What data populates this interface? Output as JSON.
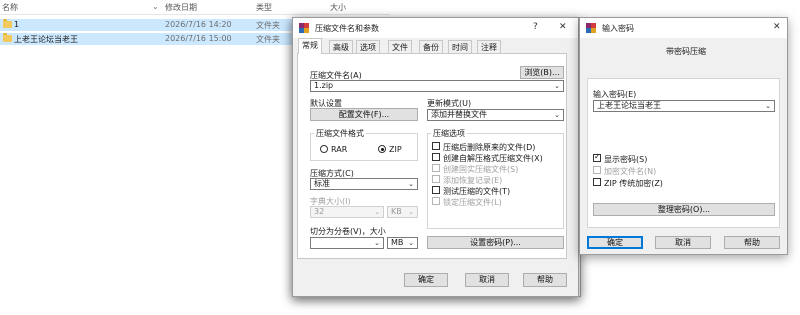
{
  "explorer": {
    "columns": {
      "name": "名称",
      "date": "修改日期",
      "type": "类型",
      "size": "大小"
    },
    "rows": [
      {
        "name": "1",
        "date": "2026/7/16 14:20",
        "type": "文件夹"
      },
      {
        "name": "上老王论坛当老王",
        "date": "2026/7/16 15:00",
        "type": "文件夹"
      }
    ]
  },
  "archive_dialog": {
    "title": "压缩文件名和参数",
    "help_glyph": "?",
    "close_glyph": "✕",
    "tabs": [
      "常规",
      "高级",
      "选项",
      "文件",
      "备份",
      "时间",
      "注释"
    ],
    "archive_name_label": "压缩文件名(A)",
    "browse_button": "浏览(B)...",
    "archive_name_value": "1.zip",
    "default_settings_label": "默认设置",
    "profiles_button": "配置文件(F)...",
    "update_mode_label": "更新模式(U)",
    "update_mode_value": "添加并替换文件",
    "format_group_title": "压缩文件格式",
    "format_rar": "RAR",
    "format_zip": "ZIP",
    "selected_format": "ZIP",
    "method_label": "压缩方式(C)",
    "method_value": "标准",
    "dict_label": "字典大小(I)",
    "dict_value": "32",
    "dict_unit": "KB",
    "split_label": "切分为分卷(V)，大小",
    "split_value": "",
    "split_unit": "MB",
    "options_group_title": "压缩选项",
    "options": [
      {
        "label": "压缩后删除原来的文件(D)",
        "checked": false,
        "disabled": false
      },
      {
        "label": "创建自解压格式压缩文件(X)",
        "checked": false,
        "disabled": false
      },
      {
        "label": "创建固实压缩文件(S)",
        "checked": false,
        "disabled": true
      },
      {
        "label": "添加恢复记录(E)",
        "checked": false,
        "disabled": true
      },
      {
        "label": "测试压缩的文件(T)",
        "checked": false,
        "disabled": false
      },
      {
        "label": "锁定压缩文件(L)",
        "checked": false,
        "disabled": true
      }
    ],
    "set_password_button": "设置密码(P)...",
    "ok_button": "确定",
    "cancel_button": "取消",
    "help_button": "帮助"
  },
  "password_dialog": {
    "title": "输入密码",
    "close_glyph": "✕",
    "header": "带密码压缩",
    "password_label": "输入密码(E)",
    "password_value": "上老王论坛当老王",
    "show_password_label": "显示密码(S)",
    "show_password_checked": true,
    "encrypt_names_label": "加密文件名(N)",
    "encrypt_names_disabled": true,
    "zip_legacy_label": "ZIP 传统加密(Z)",
    "zip_legacy_checked": false,
    "organize_button": "整理密码(O)...",
    "ok_button": "确定",
    "cancel_button": "取消",
    "help_button": "帮助"
  },
  "icons": {
    "folder": "folder-icon",
    "winrar": "winrar-icon",
    "sort_arrow": "chevron-down-icon"
  },
  "colors": {
    "selection": "#cce8ff",
    "dialog_bg": "#f0f0f0",
    "focus": "#0078d7"
  }
}
